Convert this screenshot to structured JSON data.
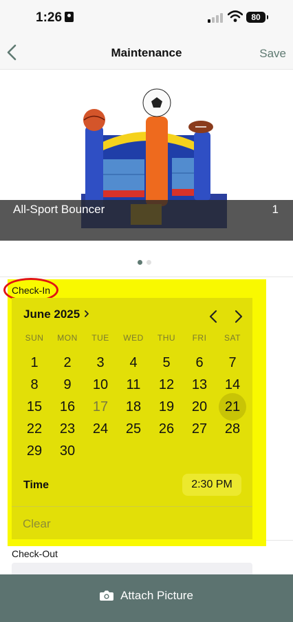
{
  "status_bar": {
    "time": "1:26",
    "battery": "80"
  },
  "nav": {
    "title": "Maintenance",
    "save_label": "Save"
  },
  "hero": {
    "name": "All-Sport Bouncer",
    "count": "1"
  },
  "checkin": {
    "label": "Check-In",
    "month_label": "June 2025",
    "weekdays": [
      "SUN",
      "MON",
      "TUE",
      "WED",
      "THU",
      "FRI",
      "SAT"
    ],
    "days": [
      "1",
      "2",
      "3",
      "4",
      "5",
      "6",
      "7",
      "8",
      "9",
      "10",
      "11",
      "12",
      "13",
      "14",
      "15",
      "16",
      "17",
      "18",
      "19",
      "20",
      "21",
      "22",
      "23",
      "24",
      "25",
      "26",
      "27",
      "28",
      "29",
      "30"
    ],
    "first_weekday_index": 0,
    "today": "17",
    "selected": "21",
    "time_label": "Time",
    "time_value": "2:30 PM",
    "clear_label": "Clear"
  },
  "checkout": {
    "label": "Check-Out"
  },
  "bottom": {
    "attach_label": "Attach Picture"
  },
  "colors": {
    "accent": "#5f7a72",
    "bottom_bar": "#5c7370",
    "highlight": "#f9f900",
    "annotation": "#e01313"
  }
}
